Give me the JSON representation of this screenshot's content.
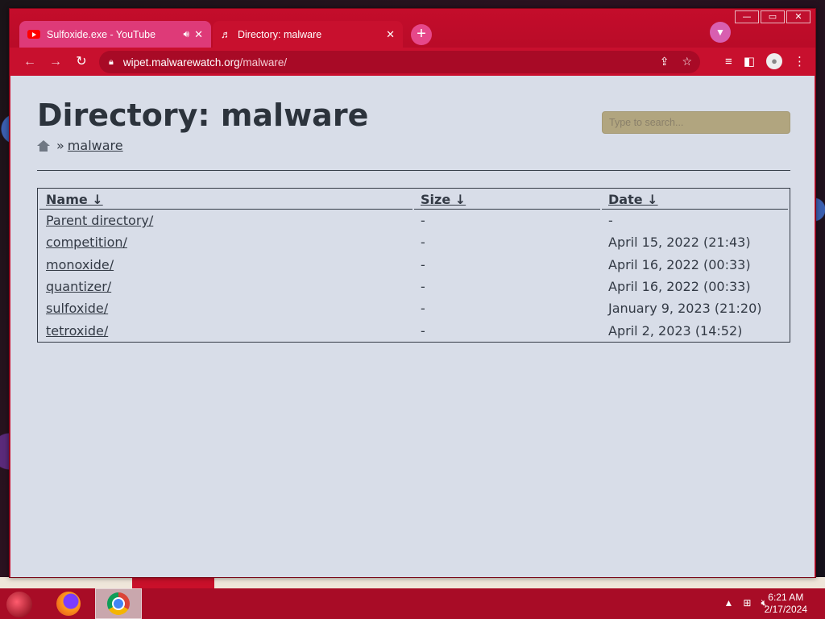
{
  "browser": {
    "tabs": [
      {
        "title": "Sulfoxide.exe - YouTube",
        "active": false,
        "audio": true
      },
      {
        "title": "Directory: malware",
        "active": true,
        "audio": false
      }
    ],
    "address": {
      "domain": "wipet.malwarewatch.org",
      "path": "/malware/"
    },
    "window_controls": {
      "minimize": "—",
      "maximize": "▭",
      "close": "✕"
    },
    "icons": {
      "back": "arrow-left-icon",
      "forward": "arrow-right-icon",
      "reload": "reload-icon",
      "new_tab": "plus-icon",
      "tab_search": "chevron-down-icon"
    }
  },
  "page": {
    "title": "Directory: malware",
    "search": {
      "placeholder": "Type to search...",
      "value": ""
    },
    "breadcrumb": {
      "separator": "»",
      "current": "malware"
    },
    "table": {
      "headers": [
        "Name ↓",
        "Size ↓",
        "Date ↓"
      ],
      "rows": [
        {
          "name": "Parent directory/",
          "size": "-",
          "date": "-"
        },
        {
          "name": "competition/",
          "size": "-",
          "date": "April 15, 2022 (21:43)"
        },
        {
          "name": "monoxide/",
          "size": "-",
          "date": "April 16, 2022 (00:33)"
        },
        {
          "name": "quantizer/",
          "size": "-",
          "date": "April 16, 2022 (00:33)"
        },
        {
          "name": "sulfoxide/",
          "size": "-",
          "date": "January 9, 2023 (21:20)"
        },
        {
          "name": "tetroxide/",
          "size": "-",
          "date": "April 2, 2023 (14:52)"
        }
      ]
    }
  },
  "taskbar": {
    "apps": [
      "firefox-icon",
      "chrome-icon"
    ],
    "clock": {
      "time": "6:21 AM",
      "date": "2/17/2024"
    }
  },
  "colors": {
    "browser_frame": "#c8102e",
    "page_bg": "#d8dde8",
    "search_bg": "#b1a57f",
    "taskbar": "#a80c26"
  }
}
